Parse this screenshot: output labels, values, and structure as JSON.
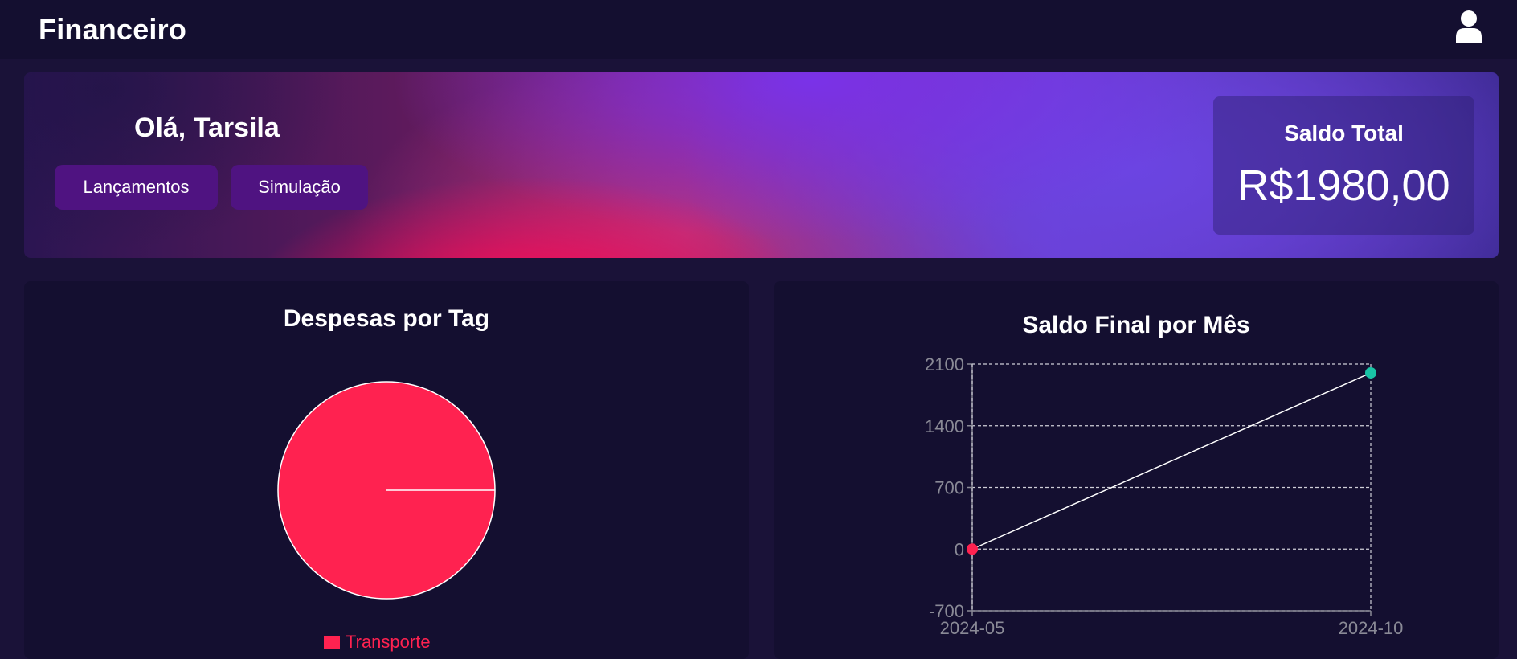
{
  "header": {
    "app_title": "Financeiro",
    "user_icon": "user-icon"
  },
  "hero": {
    "greeting": "Olá, Tarsila",
    "buttons": [
      {
        "label": "Lançamentos"
      },
      {
        "label": "Simulação"
      }
    ],
    "balance": {
      "label": "Saldo Total",
      "value": "R$1980,00"
    }
  },
  "expenses_panel": {
    "title": "Despesas por Tag"
  },
  "balance_panel": {
    "title": "Saldo Final por Mês"
  },
  "colors": {
    "accent_red": "#ff2250",
    "teal": "#19c3a5",
    "button_purple": "#4f1381"
  },
  "chart_data": [
    {
      "type": "pie",
      "title": "Despesas por Tag",
      "categories": [
        "Transporte"
      ],
      "values": [
        100
      ],
      "colors": [
        "#ff2250"
      ],
      "legend": "bottom"
    },
    {
      "type": "line",
      "title": "Saldo Final por Mês",
      "x": [
        "2024-05",
        "2024-10"
      ],
      "series": [
        {
          "values": [
            0,
            2000
          ]
        }
      ],
      "point_colors": [
        "#ff2250",
        "#19c3a5"
      ],
      "yticks": [
        -700,
        0,
        700,
        1400,
        2100
      ],
      "ylim": [
        -700,
        2100
      ],
      "grid": true
    }
  ]
}
